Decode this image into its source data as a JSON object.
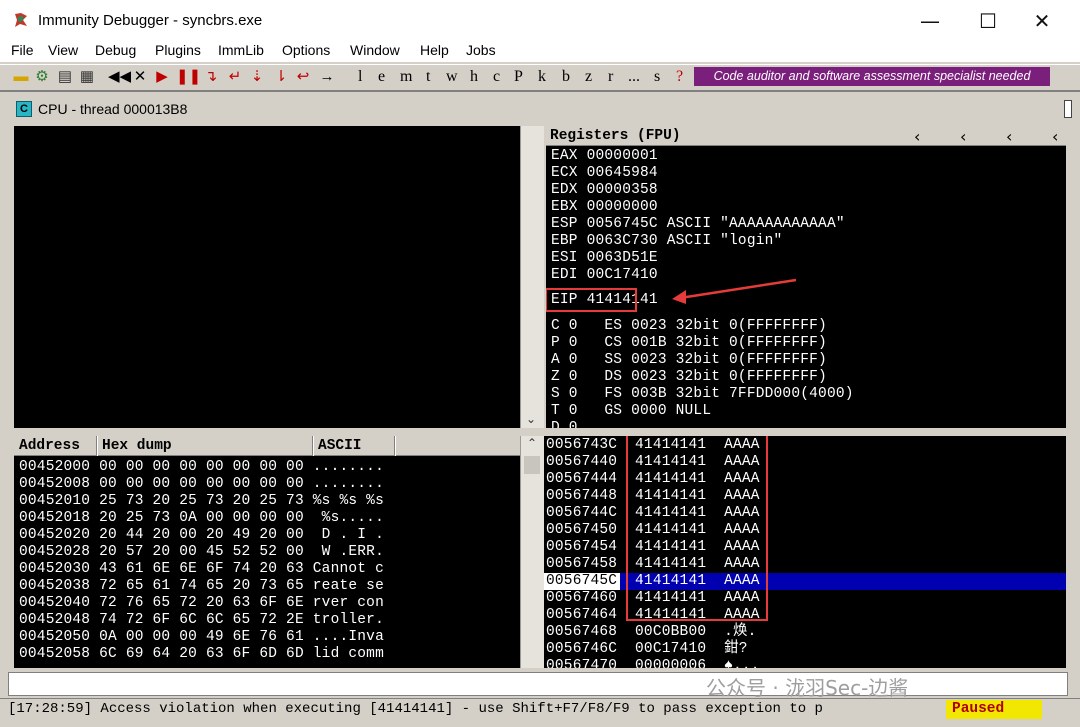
{
  "window": {
    "title": "Immunity Debugger - syncbrs.exe",
    "minimize": "—",
    "maximize": "☐",
    "close": "✕"
  },
  "menu": [
    "File",
    "View",
    "Debug",
    "Plugins",
    "ImmLib",
    "Options",
    "Window",
    "Help",
    "Jobs"
  ],
  "toolbar": {
    "letters": [
      "l",
      "e",
      "m",
      "t",
      "w",
      "h",
      "c",
      "P",
      "k",
      "b",
      "z",
      "r",
      "...",
      "s",
      "?"
    ],
    "banner": "Code auditor and software assessment specialist needed"
  },
  "cpu_window": {
    "title": "CPU - thread 000013B8"
  },
  "registers": {
    "header": "Registers (FPU)",
    "lines": [
      "EAX 00000001",
      "ECX 00645984",
      "EDX 00000358",
      "EBX 00000000",
      "ESP 0056745C ASCII \"AAAAAAAAAAAA\"",
      "EBP 0063C730 ASCII \"login\"",
      "ESI 0063D51E",
      "EDI 00C17410"
    ],
    "eip": "EIP 41414141",
    "flags": [
      "C 0   ES 0023 32bit 0(FFFFFFFF)",
      "P 0   CS 001B 32bit 0(FFFFFFFF)",
      "A 0   SS 0023 32bit 0(FFFFFFFF)",
      "Z 0   DS 0023 32bit 0(FFFFFFFF)",
      "S 0   FS 003B 32bit 7FFDD000(4000)",
      "T 0   GS 0000 NULL",
      "D 0"
    ]
  },
  "dump": {
    "headers": [
      "Address",
      "Hex dump",
      "ASCII"
    ],
    "rows": [
      {
        "addr": "00452000",
        "hex": "00 00 00 00 00 00 00 00",
        "ascii": "........"
      },
      {
        "addr": "00452008",
        "hex": "00 00 00 00 00 00 00 00",
        "ascii": "........"
      },
      {
        "addr": "00452010",
        "hex": "25 73 20 25 73 20 25 73",
        "ascii": "%s %s %s"
      },
      {
        "addr": "00452018",
        "hex": "20 25 73 0A 00 00 00 00",
        "ascii": " %s....."
      },
      {
        "addr": "00452020",
        "hex": "20 44 20 00 20 49 20 00",
        "ascii": " D . I ."
      },
      {
        "addr": "00452028",
        "hex": "20 57 20 00 45 52 52 00",
        "ascii": " W .ERR."
      },
      {
        "addr": "00452030",
        "hex": "43 61 6E 6E 6F 74 20 63",
        "ascii": "Cannot c"
      },
      {
        "addr": "00452038",
        "hex": "72 65 61 74 65 20 73 65",
        "ascii": "reate se"
      },
      {
        "addr": "00452040",
        "hex": "72 76 65 72 20 63 6F 6E",
        "ascii": "rver con"
      },
      {
        "addr": "00452048",
        "hex": "74 72 6F 6C 6C 65 72 2E",
        "ascii": "troller."
      },
      {
        "addr": "00452050",
        "hex": "0A 00 00 00 49 6E 76 61",
        "ascii": "....Inva"
      },
      {
        "addr": "00452058",
        "hex": "6C 69 64 20 63 6F 6D 6D",
        "ascii": "lid comm"
      }
    ]
  },
  "stack": {
    "rows": [
      {
        "addr": "0056743C",
        "val": "41414141",
        "comment": "AAAA"
      },
      {
        "addr": "00567440",
        "val": "41414141",
        "comment": "AAAA"
      },
      {
        "addr": "00567444",
        "val": "41414141",
        "comment": "AAAA"
      },
      {
        "addr": "00567448",
        "val": "41414141",
        "comment": "AAAA"
      },
      {
        "addr": "0056744C",
        "val": "41414141",
        "comment": "AAAA"
      },
      {
        "addr": "00567450",
        "val": "41414141",
        "comment": "AAAA"
      },
      {
        "addr": "00567454",
        "val": "41414141",
        "comment": "AAAA"
      },
      {
        "addr": "00567458",
        "val": "41414141",
        "comment": "AAAA"
      },
      {
        "addr": "0056745C",
        "val": "41414141",
        "comment": "AAAA"
      },
      {
        "addr": "00567460",
        "val": "41414141",
        "comment": "AAAA"
      },
      {
        "addr": "00567464",
        "val": "41414141",
        "comment": "AAAA"
      },
      {
        "addr": "00567468",
        "val": "00C0BB00",
        "comment": ".焕."
      },
      {
        "addr": "0056746C",
        "val": "00C17410",
        "comment": "鉗?"
      },
      {
        "addr": "00567470",
        "val": "00000006",
        "comment": "♠..."
      }
    ],
    "selected_index": 8
  },
  "status": {
    "message": "[17:28:59] Access violation when executing [41414141] - use Shift+F7/F8/F9 to pass exception to p",
    "state": "Paused"
  },
  "watermark": "公众号 · 泷羽Sec-边酱",
  "colors": {
    "highlight": "#e63b3b",
    "selection": "#0000b0",
    "banner": "#7b1f7d",
    "paused_bg": "#f2e700"
  }
}
